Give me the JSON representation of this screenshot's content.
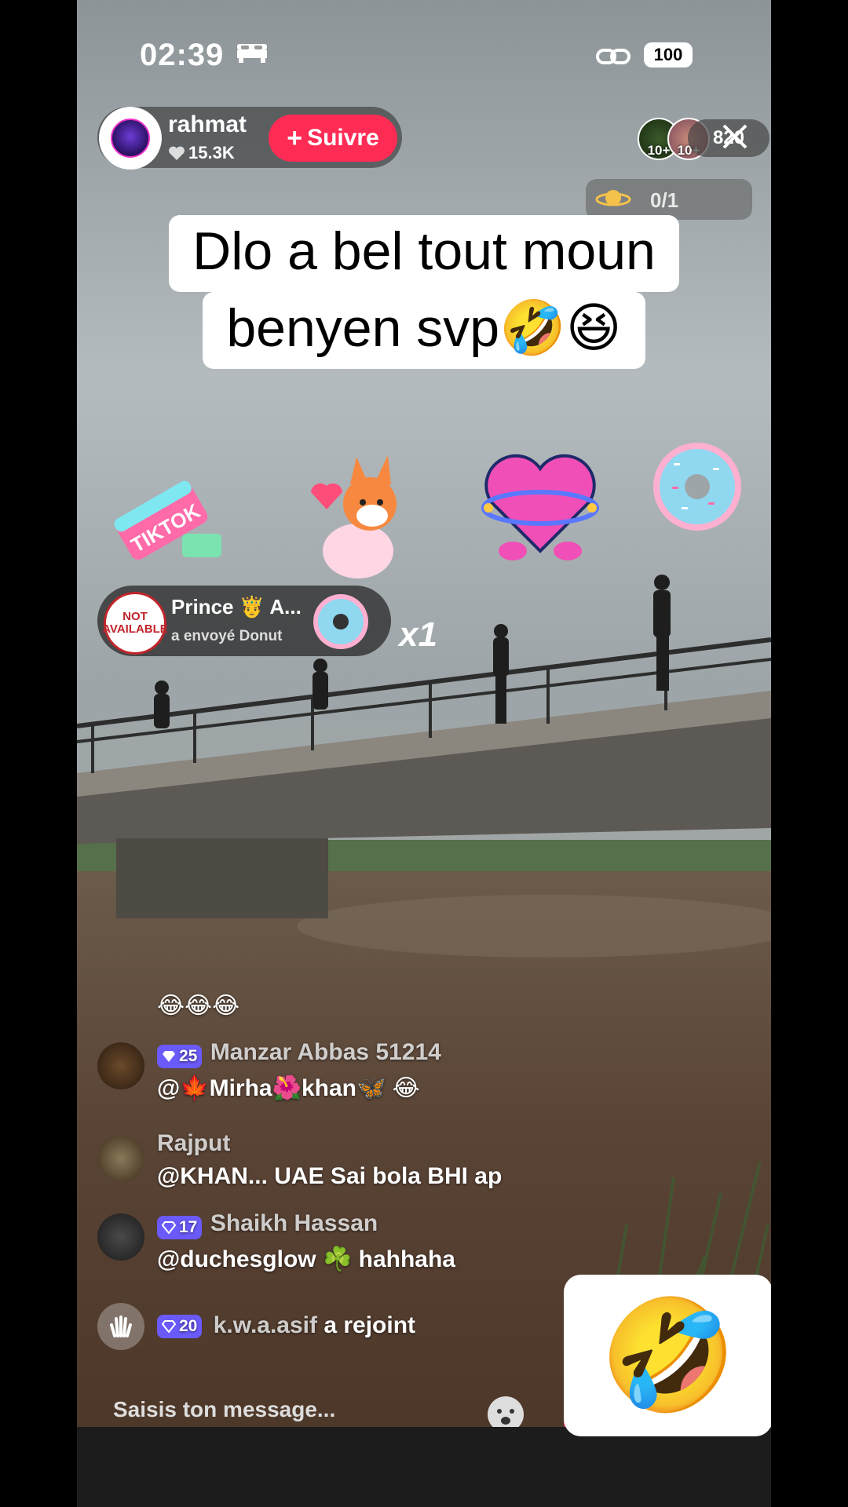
{
  "status_bar": {
    "time": "02:39",
    "battery": "100",
    "sleep_icon": "bed-icon",
    "link_icon": "link-icon"
  },
  "host": {
    "name": "rahmat",
    "likes": "15.3K",
    "follow_label": "Suivre"
  },
  "viewers": {
    "badge_1": "10+",
    "badge_2": "10+",
    "count": "820"
  },
  "goal": {
    "progress": "0/1"
  },
  "caption": {
    "line1": "Dlo a bel tout moun",
    "line2": "benyen svp🤣😆"
  },
  "gifts_floating": [
    "tiktok-gift-icon",
    "corgi-gift-icon",
    "heart-planet-gift-icon",
    "donut-gift-icon"
  ],
  "gift_banner": {
    "sender": "Prince 🤴 A...",
    "action": "a envoyé  Donut",
    "avatar_text": "NOT AVAILABLE",
    "multiplier": "x1"
  },
  "chat": {
    "emoji_line": "😂😂😂",
    "messages": [
      {
        "level": "25",
        "user": "Manzar Abbas 51214",
        "text": "@🍁Mirha🌺khan🦋 😂"
      },
      {
        "level": "",
        "user": "Rajput",
        "text": "@KHAN... UAE Sai bola BHI ap"
      },
      {
        "level": "17",
        "user": "Shaikh Hassan",
        "text": "@duchesglow ☘️ hahhaha"
      }
    ],
    "join": {
      "level": "20",
      "user": "k.w.a.asif",
      "action": "a rejoint"
    }
  },
  "input": {
    "placeholder": "Saisis ton message..."
  },
  "reaction_emoji": "🤣",
  "colors": {
    "follow": "#fe2c55",
    "badge": "#6a5af9"
  }
}
